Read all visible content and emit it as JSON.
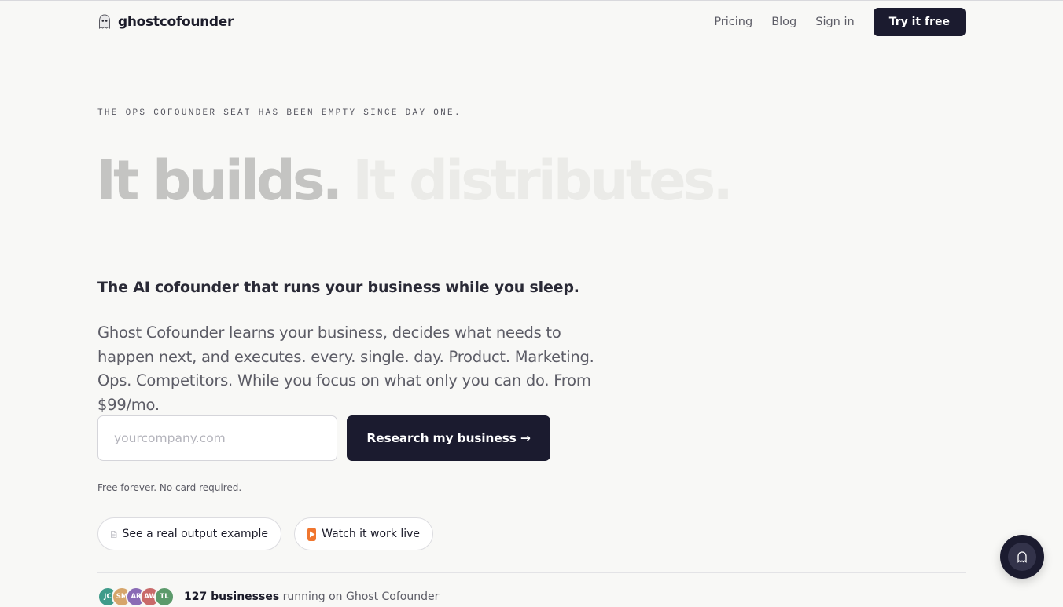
{
  "header": {
    "logo_text": "ghostcofounder",
    "nav": [
      {
        "label": "Pricing"
      },
      {
        "label": "Blog"
      },
      {
        "label": "Sign in"
      }
    ],
    "cta_label": "Try it free"
  },
  "hero": {
    "eyebrow": "THE OPS COFOUNDER SEAT HAS BEEN EMPTY SINCE DAY ONE.",
    "headline_part1": "It builds.",
    "headline_part2": "It distributes.",
    "tagline": "The AI cofounder that runs your business while you sleep.",
    "description": "Ghost Cofounder learns your business, decides what needs to happen next, and executes. every. single. day. Product. Marketing. Ops. Competitors. While you focus on what only you can do. From $99/mo.",
    "input": {
      "value": "",
      "placeholder": "yourcompany.com"
    },
    "submit_label": "Research my business →",
    "free_note": "Free forever. No card required.",
    "links": [
      {
        "label": "See a real output example",
        "icon": "document-icon"
      },
      {
        "label": "Watch it work live",
        "icon": "play-button-icon"
      }
    ]
  },
  "social_proof": {
    "avatars": [
      {
        "initials": "JC",
        "color": "#3f9b8a"
      },
      {
        "initials": "SM",
        "color": "#d6a56b"
      },
      {
        "initials": "AR",
        "color": "#8a6bb5"
      },
      {
        "initials": "AW",
        "color": "#c96a6a"
      },
      {
        "initials": "TL",
        "color": "#5c9a6b"
      }
    ],
    "count_text": "127 businesses",
    "suffix_text": "running on Ghost Cofounder"
  },
  "chat": {
    "icon": "ghost-chat-icon"
  }
}
